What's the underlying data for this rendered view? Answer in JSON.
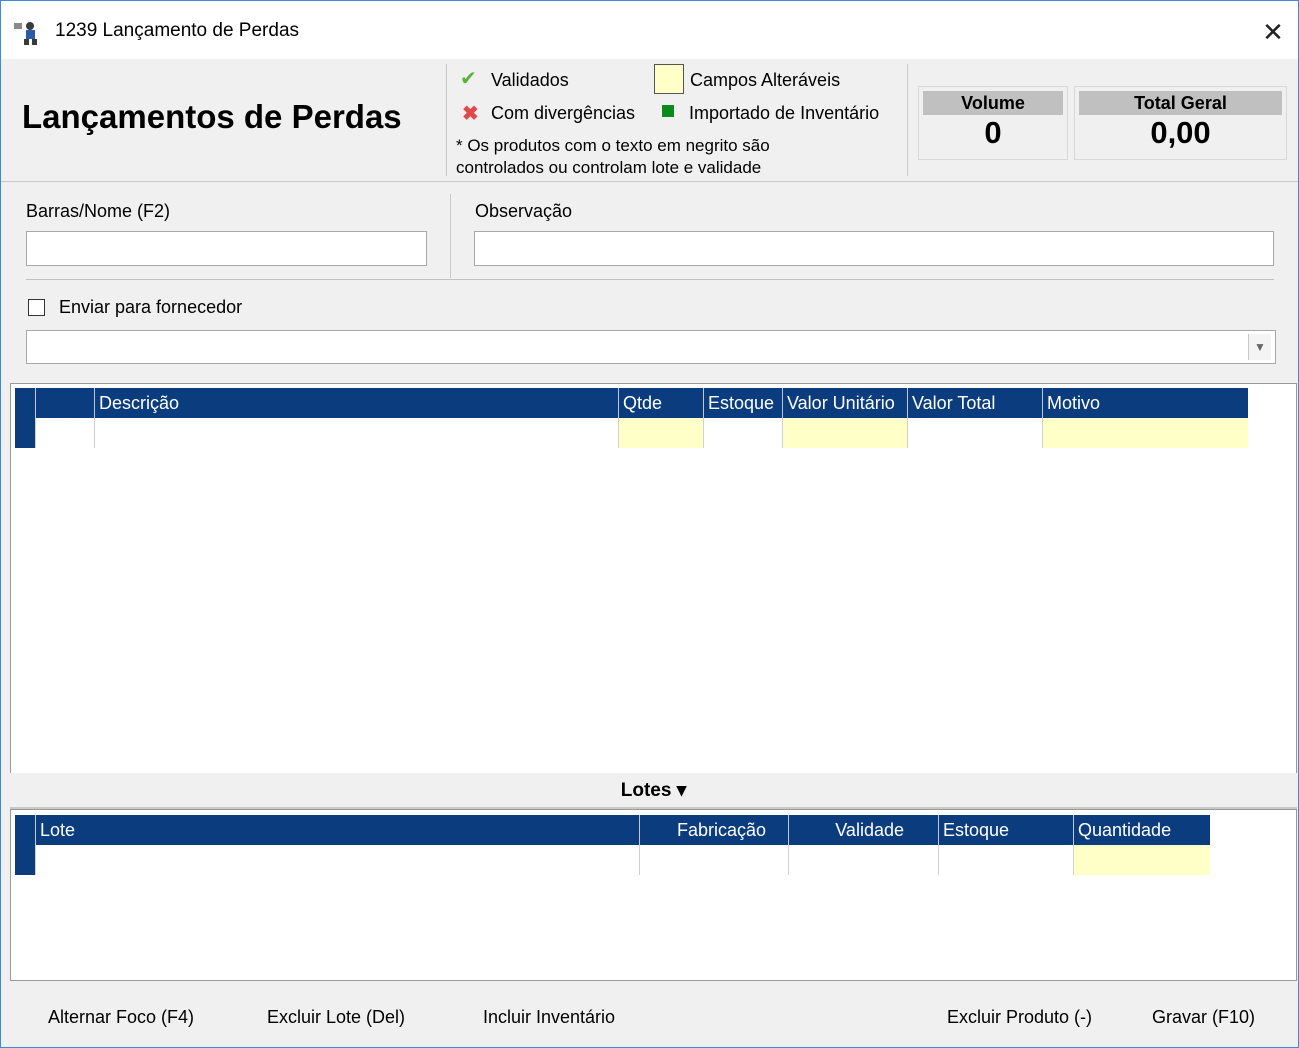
{
  "window": {
    "title": "1239 Lançamento de Perdas",
    "close_label": "✕"
  },
  "header": {
    "title": "Lançamentos de Perdas",
    "legend": {
      "validated": "Validados",
      "divergent": "Com divergências",
      "editable": "Campos Alteráveis",
      "imported": "Importado de Inventário",
      "note_line1": "* Os produtos com o texto em negrito são",
      "note_line2": "controlados ou controlam lote e validade"
    },
    "volume": {
      "label": "Volume",
      "value": "0"
    },
    "total": {
      "label": "Total Geral",
      "value": "0,00"
    }
  },
  "form": {
    "barras_label": "Barras/Nome (F2)",
    "barras_value": "",
    "observacao_label": "Observação",
    "observacao_value": "",
    "enviar_label": "Enviar para fornecedor",
    "enviar_checked": false,
    "fornecedor_value": ""
  },
  "products_grid": {
    "columns": [
      "Descrição",
      "Qtde",
      "Estoque",
      "Valor Unitário",
      "Valor Total",
      "Motivo"
    ]
  },
  "lotes": {
    "toggle_label": "Lotes ▾",
    "columns": [
      "Lote",
      "Fabricação",
      "Validade",
      "Estoque",
      "Quantidade"
    ]
  },
  "footer": {
    "alternar": "Alternar Foco (F4)",
    "excluir_lote": "Excluir Lote (Del)",
    "incluir_inventario": "Incluir Inventário",
    "excluir_produto": "Excluir Produto (-)",
    "gravar": "Gravar (F10)"
  },
  "colors": {
    "grid_header": "#0b3d7e",
    "editable_cell": "#ffffc8",
    "validated_icon": "#5ab23a",
    "divergent_icon": "#e04a4a",
    "imported_square": "#0a8a1a"
  }
}
